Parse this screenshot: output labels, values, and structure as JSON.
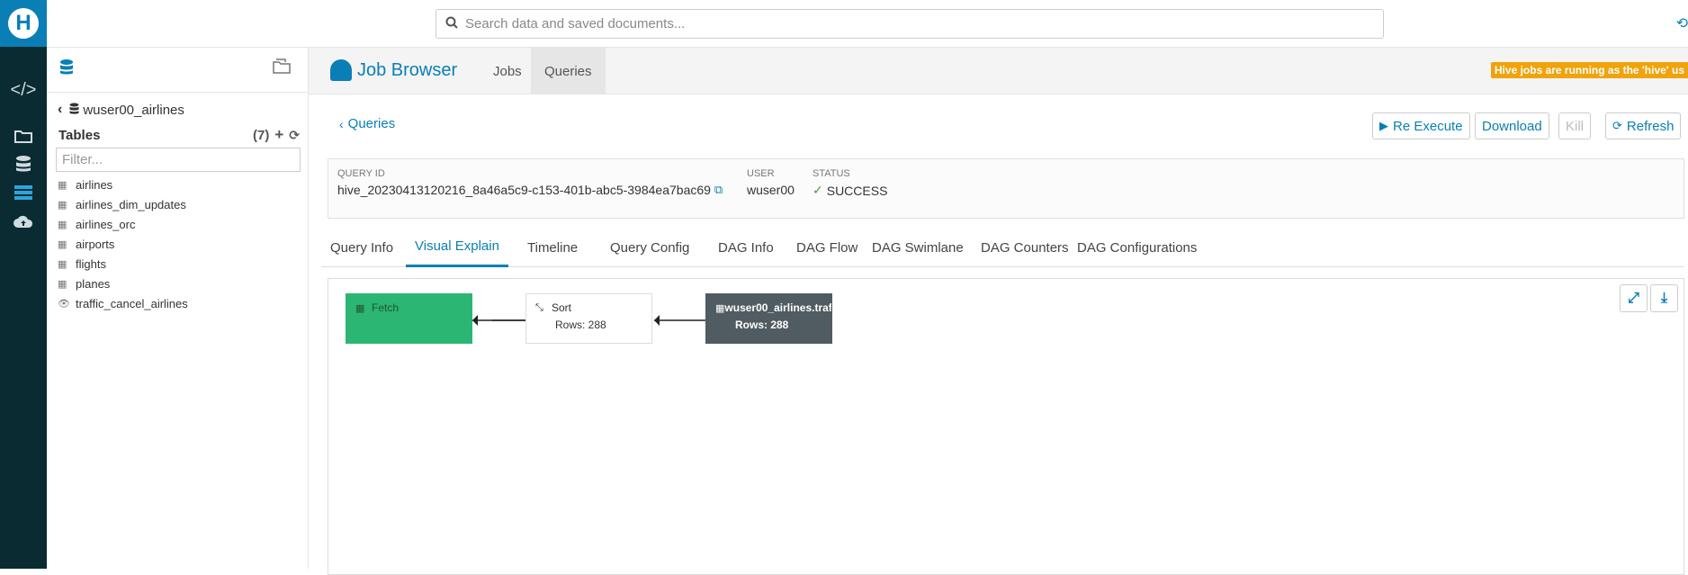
{
  "app": {
    "logo_letter": "H"
  },
  "search": {
    "placeholder": "Search data and saved documents..."
  },
  "left_panel": {
    "database": "wuser00_airlines",
    "tables_heading": "Tables",
    "tables_count": "(7)",
    "filter_placeholder": "Filter...",
    "tables": [
      {
        "name": "airlines",
        "icon": "table-icon"
      },
      {
        "name": "airlines_dim_updates",
        "icon": "table-icon"
      },
      {
        "name": "airlines_orc",
        "icon": "table-icon"
      },
      {
        "name": "airports",
        "icon": "table-icon"
      },
      {
        "name": "flights",
        "icon": "table-icon"
      },
      {
        "name": "planes",
        "icon": "table-icon"
      },
      {
        "name": "traffic_cancel_airlines",
        "icon": "view-icon"
      }
    ]
  },
  "header": {
    "title": "Job Browser",
    "tabs": [
      "Jobs",
      "Queries"
    ],
    "active_tab": "Queries",
    "notice": "Hive jobs are running as the 'hive' us"
  },
  "toolbar": {
    "back_label": "Queries",
    "reexecute_label": "Re Execute",
    "download_label": "Download",
    "kill_label": "Kill",
    "refresh_label": "Refresh"
  },
  "query": {
    "id_label": "QUERY ID",
    "id": "hive_20230413120216_8a46a5c9-c153-401b-abc5-3984ea7bac69",
    "user_label": "USER",
    "user": "wuser00",
    "status_label": "STATUS",
    "status": "SUCCESS"
  },
  "detail_tabs": [
    "Query Info",
    "Visual Explain",
    "Timeline",
    "Query Config",
    "DAG Info",
    "DAG Flow",
    "DAG Swimlane",
    "DAG Counters",
    "DAG Configurations"
  ],
  "active_detail_tab": "Visual Explain",
  "explain": {
    "nodes": [
      {
        "name": "Fetch",
        "rows": ""
      },
      {
        "name": "Sort",
        "rows": "Rows: 288"
      },
      {
        "name": "wuser00_airlines.traf",
        "rows": "Rows: 288"
      }
    ]
  },
  "colors": {
    "accent": "#0a7fb5",
    "fetch_node": "#2bb673",
    "scan_node": "#505c61",
    "notice": "#f0a30a"
  }
}
